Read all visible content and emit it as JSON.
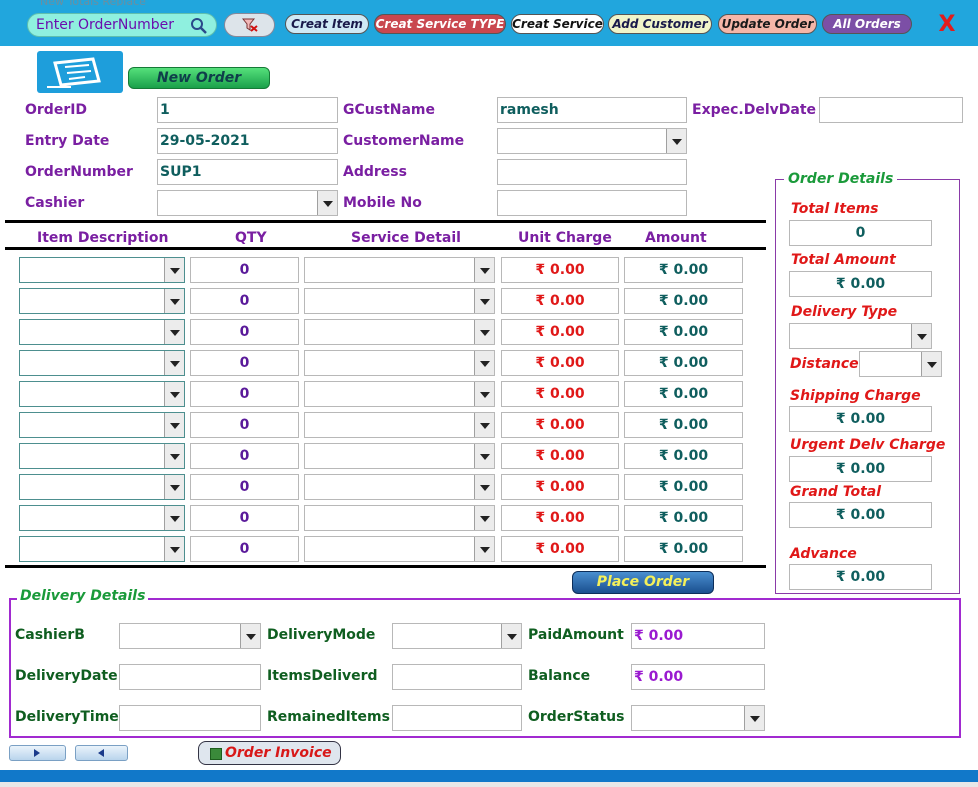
{
  "toolbar": {
    "search_label": "Enter OrderNumber",
    "ghost_text": "New          Totals          Replace",
    "buttons": [
      {
        "label": "Creat Item",
        "bg": "#cfe9f5",
        "color": "#1a1a4a"
      },
      {
        "label": "Creat Service TYPE",
        "bg": "#c9474f",
        "color": "#ffffff"
      },
      {
        "label": "Creat Service",
        "bg": "#ffffff",
        "color": "#111111"
      },
      {
        "label": "Add Customer",
        "bg": "#f1f4c9",
        "color": "#1a1a4a"
      },
      {
        "label": "Update Order",
        "bg": "#f5b6a8",
        "color": "#1a1a1a"
      },
      {
        "label": "All Orders",
        "bg": "#7c4fa6",
        "color": "#ffffff"
      }
    ],
    "close_label": "X"
  },
  "new_order_label": "New Order",
  "order": {
    "order_id_label": "OrderID",
    "order_id": "1",
    "entry_date_label": "Entry Date",
    "entry_date": "29-05-2021",
    "order_number_label": "OrderNumber",
    "order_number": "SUP1",
    "cashier_label": "Cashier",
    "cashier": "",
    "gcustname_label": "GCustName",
    "gcustname": "ramesh",
    "customer_name_label": "CustomerName",
    "customer_name": "",
    "address_label": "Address",
    "address": "",
    "mobile_label": "Mobile No",
    "mobile": "",
    "expec_delv_label": "Expec.DelvDate",
    "expec_delv": ""
  },
  "items": {
    "headers": {
      "item": "Item Description",
      "qty": "QTY",
      "service": "Service Detail",
      "unit_charge": "Unit Charge",
      "amount": "Amount"
    },
    "rows": [
      {
        "item": "",
        "qty": "0",
        "service": "",
        "unit_charge": "₹ 0.00",
        "amount": "₹ 0.00"
      },
      {
        "item": "",
        "qty": "0",
        "service": "",
        "unit_charge": "₹ 0.00",
        "amount": "₹ 0.00"
      },
      {
        "item": "",
        "qty": "0",
        "service": "",
        "unit_charge": "₹ 0.00",
        "amount": "₹ 0.00"
      },
      {
        "item": "",
        "qty": "0",
        "service": "",
        "unit_charge": "₹ 0.00",
        "amount": "₹ 0.00"
      },
      {
        "item": "",
        "qty": "0",
        "service": "",
        "unit_charge": "₹ 0.00",
        "amount": "₹ 0.00"
      },
      {
        "item": "",
        "qty": "0",
        "service": "",
        "unit_charge": "₹ 0.00",
        "amount": "₹ 0.00"
      },
      {
        "item": "",
        "qty": "0",
        "service": "",
        "unit_charge": "₹ 0.00",
        "amount": "₹ 0.00"
      },
      {
        "item": "",
        "qty": "0",
        "service": "",
        "unit_charge": "₹ 0.00",
        "amount": "₹ 0.00"
      },
      {
        "item": "",
        "qty": "0",
        "service": "",
        "unit_charge": "₹ 0.00",
        "amount": "₹ 0.00"
      },
      {
        "item": "",
        "qty": "0",
        "service": "",
        "unit_charge": "₹ 0.00",
        "amount": "₹ 0.00"
      }
    ]
  },
  "order_details": {
    "title": "Order Details",
    "total_items_label": "Total Items",
    "total_items": "0",
    "total_amount_label": "Total Amount",
    "total_amount": "₹ 0.00",
    "delivery_type_label": "Delivery Type",
    "delivery_type": "",
    "distance_label": "Distance",
    "distance": "",
    "shipping_label": "Shipping Charge",
    "shipping": "₹ 0.00",
    "urgent_label": "Urgent Delv Charge",
    "urgent": "₹ 0.00",
    "grand_total_label": "Grand Total",
    "grand_total": "₹ 0.00",
    "advance_label": "Advance",
    "advance": "₹ 0.00"
  },
  "place_order_label": "Place Order",
  "delivery": {
    "title": "Delivery Details",
    "cashierb_label": "CashierB",
    "cashierb": "",
    "delivery_mode_label": "DeliveryMode",
    "delivery_mode": "",
    "paid_amount_label": "PaidAmount",
    "paid_amount": "₹ 0.00",
    "delivery_date_label": "DeliveryDate",
    "delivery_date": "",
    "items_delivered_label": "ItemsDeliverd",
    "items_delivered": "",
    "balance_label": "Balance",
    "balance": "₹ 0.00",
    "delivery_time_label": "DeliveryTime",
    "delivery_time": "",
    "remained_items_label": "RemainedItems",
    "remained_items": "",
    "order_status_label": "OrderStatus",
    "order_status": ""
  },
  "order_invoice_label": "Order Invoice"
}
